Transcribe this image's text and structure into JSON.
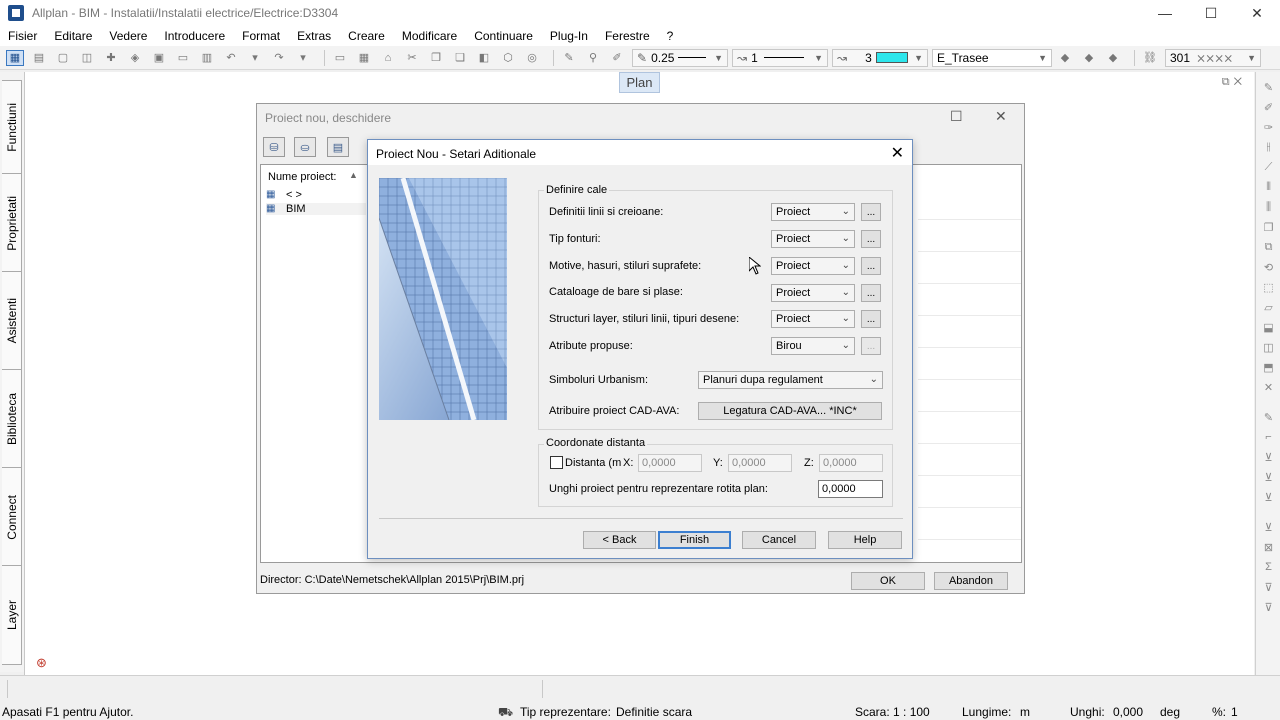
{
  "window": {
    "title": "Allplan - BIM - Instalatii/Instalatii electrice/Electrice:D3304",
    "minimize": "—",
    "maximize": "☐",
    "close": "✕"
  },
  "menu": [
    "Fisier",
    "Editare",
    "Vedere",
    "Introducere",
    "Format",
    "Extras",
    "Creare",
    "Modificare",
    "Continuare",
    "Plug-In",
    "Ferestre",
    "?"
  ],
  "toolbar": {
    "pen_value": "0.25",
    "line_value": "1",
    "color_value": "3",
    "color_hex": "#2ee6ec",
    "layer_value": "E_Trasee",
    "hatch_value": "301"
  },
  "view_label": "Plan",
  "left_tabs": [
    "Functiuni",
    "Proprietati",
    "Asistenti",
    "Biblioteca",
    "Connect",
    "Layer"
  ],
  "outer_dialog": {
    "title": "Proiect nou, deschidere",
    "list_header": "Nume proiect:",
    "rows": [
      "<        >",
      "BIM"
    ],
    "director": "Director: C:\\Date\\Nemetschek\\Allplan 2015\\Prj\\BIM.prj",
    "ok_label": "OK",
    "cancel_label": "Abandon"
  },
  "inner_dialog": {
    "title": "Proiect Nou - Setari Aditionale",
    "close": "✕",
    "paths_group": "Definire cale",
    "paths": [
      {
        "label": "Definitii linii si creioane:",
        "value": "Proiect",
        "button": "..."
      },
      {
        "label": "Tip fonturi:",
        "value": "Proiect",
        "button": "..."
      },
      {
        "label": "Motive, hasuri, stiluri suprafete:",
        "value": "Proiect",
        "button": "..."
      },
      {
        "label": "Cataloage de bare si plase:",
        "value": "Proiect",
        "button": "..."
      },
      {
        "label": "Structuri layer, stiluri linii, tipuri desene:",
        "value": "Proiect",
        "button": "..."
      },
      {
        "label": "Atribute propuse:",
        "value": "Birou",
        "button": "..."
      }
    ],
    "urbanism_label": "Simboluri Urbanism:",
    "urbanism_value": "Planuri dupa regulament",
    "cadava_label": "Atribuire proiect CAD-AVA:",
    "cadava_button": "Legatura CAD-AVA... *INC*",
    "coords_group": "Coordonate distanta",
    "distance_checkbox_label": "Distanta (m",
    "x_label": "X:",
    "x_value": "0,0000",
    "y_label": "Y:",
    "y_value": "0,0000",
    "z_label": "Z:",
    "z_value": "0,0000",
    "angle_label": "Unghi proiect pentru reprezentare rotita plan:",
    "angle_value": "0,0000",
    "back_label": "< Back",
    "finish_label": "Finish",
    "cancel_label": "Cancel",
    "help_label": "Help"
  },
  "status": {
    "help_text": "Apasati F1 pentru Ajutor.",
    "repr_label": "Tip reprezentare:",
    "repr_value": "Definitie scara",
    "scale": "Scara: 1 : 100",
    "length_label": "Lungime:",
    "length_unit": "m",
    "angle_label": "Unghi:",
    "angle_value": "0,000",
    "angle_unit": "deg",
    "percent_label": "%:",
    "percent_value": "1"
  }
}
